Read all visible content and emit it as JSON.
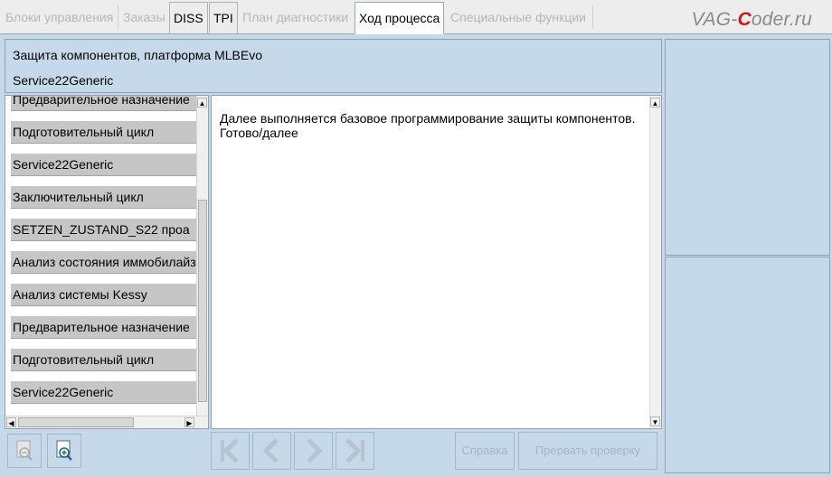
{
  "tabs": [
    {
      "label": "Блоки управления",
      "state": "disabled"
    },
    {
      "label": "Заказы",
      "state": "disabled"
    },
    {
      "label": "DISS",
      "state": "enabled"
    },
    {
      "label": "TPI",
      "state": "enabled"
    },
    {
      "label": "План диагностики",
      "state": "disabled"
    },
    {
      "label": "Ход процесса",
      "state": "active"
    },
    {
      "label": "Специальные функции",
      "state": "disabled"
    }
  ],
  "watermark": {
    "prefix": "VAG-",
    "accent": "C",
    "suffix": "oder.ru",
    "accent_color": "#d2131b"
  },
  "header": {
    "title": "Защита компонентов, платформа MLBEvo",
    "subtitle": "Service22Generic"
  },
  "steps": [
    "Предварительное назначение",
    "Подготовительный цикл",
    "Service22Generic",
    "Заключительный цикл",
    "SETZEN_ZUSTAND_S22 проа",
    "Анализ состояния иммобилайз",
    "Анализ системы Kessy",
    "Предварительное назначение",
    "Подготовительный цикл",
    "Service22Generic"
  ],
  "message": {
    "line1": "Далее выполняется базовое программирование защиты компонентов.",
    "line2": "Готово/далее"
  },
  "toolbar": {
    "zoom_out_icon": "zoom-out-icon",
    "zoom_in_icon": "zoom-in-icon"
  },
  "navigation": {
    "first_icon": "skip-first-icon",
    "prev_icon": "chevron-left-icon",
    "next_icon": "chevron-right-icon",
    "last_icon": "skip-last-icon"
  },
  "buttons": {
    "help": "Справка",
    "abort": "Прервать проверку"
  },
  "colors": {
    "background": "#c6d9ea",
    "disabled_text": "#b6b6b6",
    "step_fill": "#c6c6c6"
  }
}
